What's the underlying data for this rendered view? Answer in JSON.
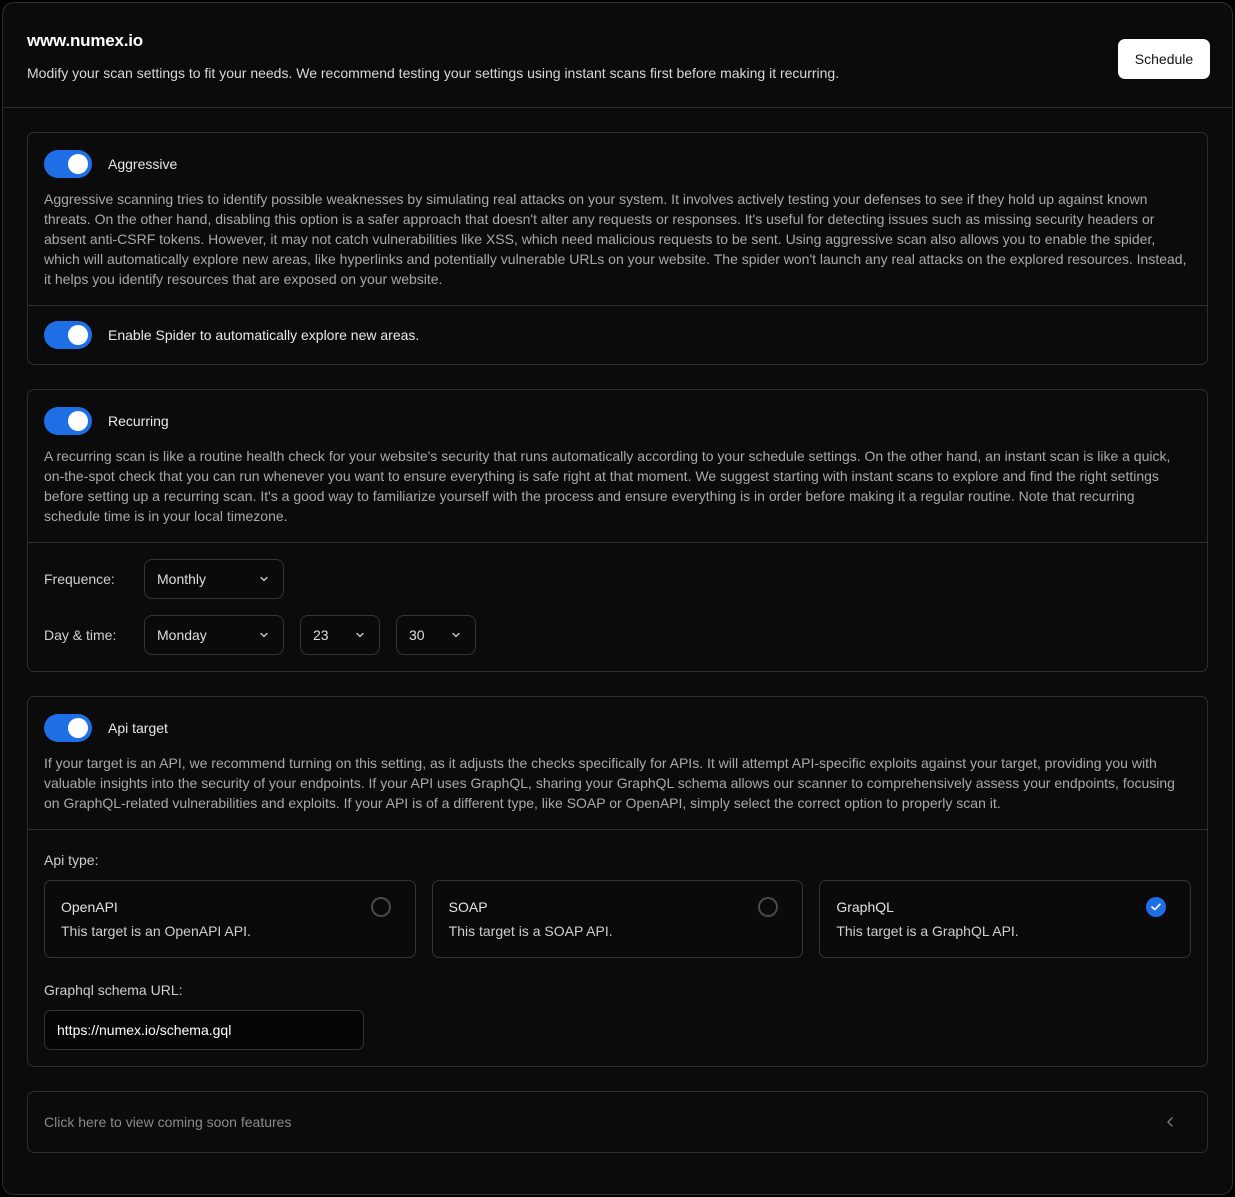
{
  "header": {
    "title": "www.numex.io",
    "description": "Modify your scan settings to fit your needs. We recommend testing your settings using instant scans first before making it recurring.",
    "schedule_label": "Schedule"
  },
  "aggressive": {
    "enabled": true,
    "label": "Aggressive",
    "description": "Aggressive scanning tries to identify possible weaknesses by simulating real attacks on your system. It involves actively testing your defenses to see if they hold up against known threats. On the other hand, disabling this option is a safer approach that doesn't alter any requests or responses. It's useful for detecting issues such as missing security headers or absent anti-CSRF tokens. However, it may not catch vulnerabilities like XSS, which need malicious requests to be sent. Using aggressive scan also allows you to enable the spider, which will automatically explore new areas, like hyperlinks and potentially vulnerable URLs on your website. The spider won't launch any real attacks on the explored resources. Instead, it helps you identify resources that are exposed on your website.",
    "spider": {
      "enabled": true,
      "label": "Enable Spider to automatically explore new areas."
    }
  },
  "recurring": {
    "enabled": true,
    "label": "Recurring",
    "description": "A recurring scan is like a routine health check for your website's security that runs automatically according to your schedule settings. On the other hand, an instant scan is like a quick, on-the-spot check that you can run whenever you want to ensure everything is safe right at that moment. We suggest starting with instant scans to explore and find the right settings before setting up a recurring scan. It's a good way to familiarize yourself with the process and ensure everything is in order before making it a regular routine. Note that recurring schedule time is in your local timezone.",
    "frequence_label": "Frequence:",
    "frequence_value": "Monthly",
    "day_time_label": "Day & time:",
    "day_value": "Monday",
    "hour_value": "23",
    "minute_value": "30"
  },
  "api_target": {
    "enabled": true,
    "label": "Api target",
    "description": "If your target is an API, we recommend turning on this setting, as it adjusts the checks specifically for APIs. It will attempt API-specific exploits against your target, providing you with valuable insights into the security of your endpoints. If your API uses GraphQL, sharing your GraphQL schema allows our scanner to comprehensively assess your endpoints, focusing on GraphQL-related vulnerabilities and exploits. If your API is of a different type, like SOAP or OpenAPI, simply select the correct option to properly scan it.",
    "api_type_label": "Api type:",
    "options": [
      {
        "name": "OpenAPI",
        "description": "This target is an OpenAPI API.",
        "selected": false
      },
      {
        "name": "SOAP",
        "description": "This target is a SOAP API.",
        "selected": false
      },
      {
        "name": "GraphQL",
        "description": "This target is a GraphQL API.",
        "selected": true
      }
    ],
    "schema_url_label": "Graphql schema URL:",
    "schema_url_value": "https://numex.io/schema.gql"
  },
  "coming_soon": {
    "label": "Click here to view coming soon features",
    "icon": "chevron-left-icon"
  },
  "colors": {
    "accent": "#1e6fe6",
    "background": "#0b0b0c",
    "border": "#2e2e30"
  }
}
